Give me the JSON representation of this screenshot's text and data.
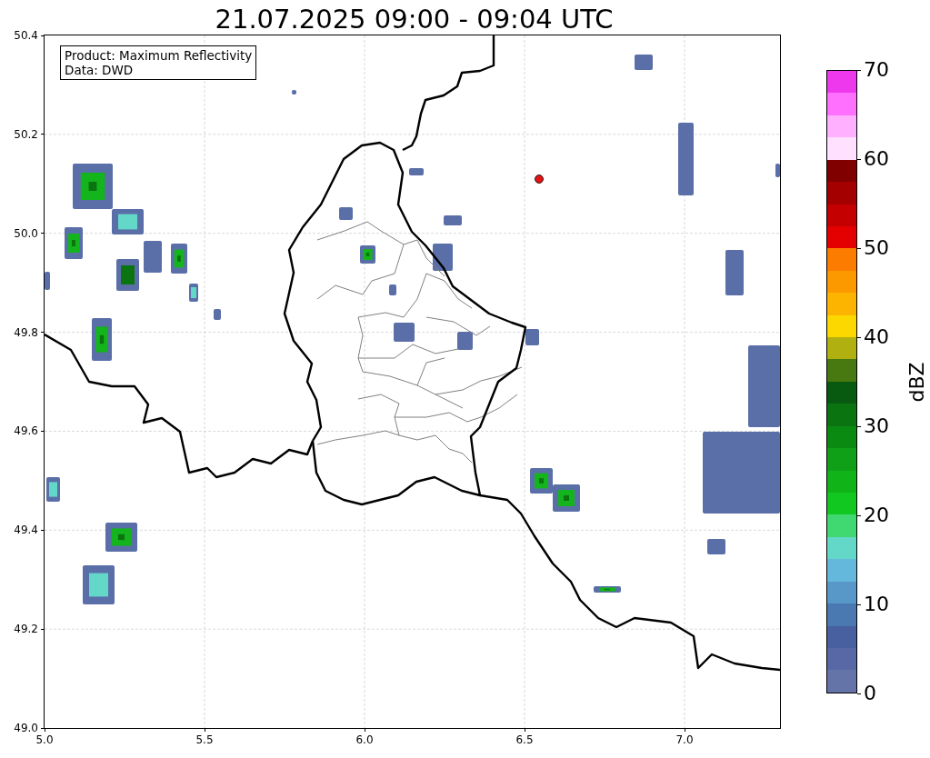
{
  "title": "21.07.2025 09:00 - 09:04 UTC",
  "info_box": {
    "lines": [
      "Product: Maximum Reflectivity",
      "Data: DWD"
    ]
  },
  "map": {
    "x_ticks": [
      "5.0",
      "5.5",
      "6.0",
      "6.5",
      "7.0"
    ],
    "y_ticks": [
      "50.4",
      "50.2",
      "50.0",
      "49.8",
      "49.6",
      "49.4",
      "49.2",
      "49.0"
    ]
  },
  "colorbar": {
    "label": "dBZ",
    "ticks": [
      "70",
      "60",
      "50",
      "40",
      "30",
      "20",
      "10",
      "0"
    ],
    "bins": [
      {
        "color": "#ee38ee"
      },
      {
        "color": "#ff70ff"
      },
      {
        "color": "#ffb0ff"
      },
      {
        "color": "#ffe0ff"
      },
      {
        "color": "#800000"
      },
      {
        "color": "#a40000"
      },
      {
        "color": "#c40000"
      },
      {
        "color": "#e40000"
      },
      {
        "color": "#fc7c00"
      },
      {
        "color": "#fc9800"
      },
      {
        "color": "#fcb400"
      },
      {
        "color": "#fcd800"
      },
      {
        "color": "#b0b010"
      },
      {
        "color": "#487810"
      },
      {
        "color": "#085a10"
      },
      {
        "color": "#0a7410"
      },
      {
        "color": "#0a8a10"
      },
      {
        "color": "#10a018"
      },
      {
        "color": "#10b418"
      },
      {
        "color": "#10c820"
      },
      {
        "color": "#40d870"
      },
      {
        "color": "#64d8c8"
      },
      {
        "color": "#64b8dc"
      },
      {
        "color": "#5898c8"
      },
      {
        "color": "#4a78b0"
      },
      {
        "color": "#4860a0"
      },
      {
        "color": "#5868a6"
      },
      {
        "color": "#6474a8"
      }
    ]
  }
}
